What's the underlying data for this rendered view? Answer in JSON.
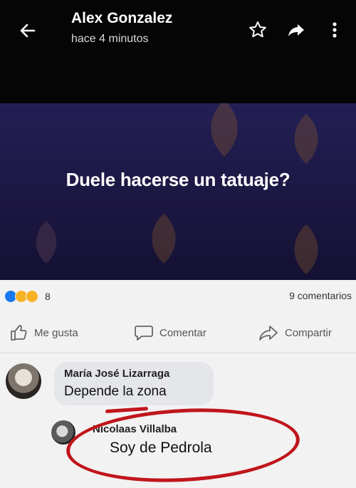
{
  "header": {
    "author": "Alex Gonzalez",
    "time": "hace 4 minutos",
    "icons": [
      "back-arrow-icon",
      "star-icon",
      "share-icon",
      "more-vertical-icon"
    ]
  },
  "post": {
    "text": "Duele hacerse un tatuaje?",
    "background_color": "#1e1a4a"
  },
  "stats": {
    "reaction_count": "8",
    "comments": "9 comentarios",
    "reaction_colors": [
      "#1877f2",
      "#f7b125",
      "#f7b125"
    ]
  },
  "actions": {
    "like": "Me gusta",
    "comment": "Comentar",
    "share": "Compartir"
  },
  "comments": [
    {
      "author": "María José Lizarraga",
      "text": "Depende la zona"
    },
    {
      "author": "Nicolaas Villalba",
      "text": "Soy de Pedrola"
    }
  ],
  "colors": {
    "highlight": "#c0151c"
  }
}
